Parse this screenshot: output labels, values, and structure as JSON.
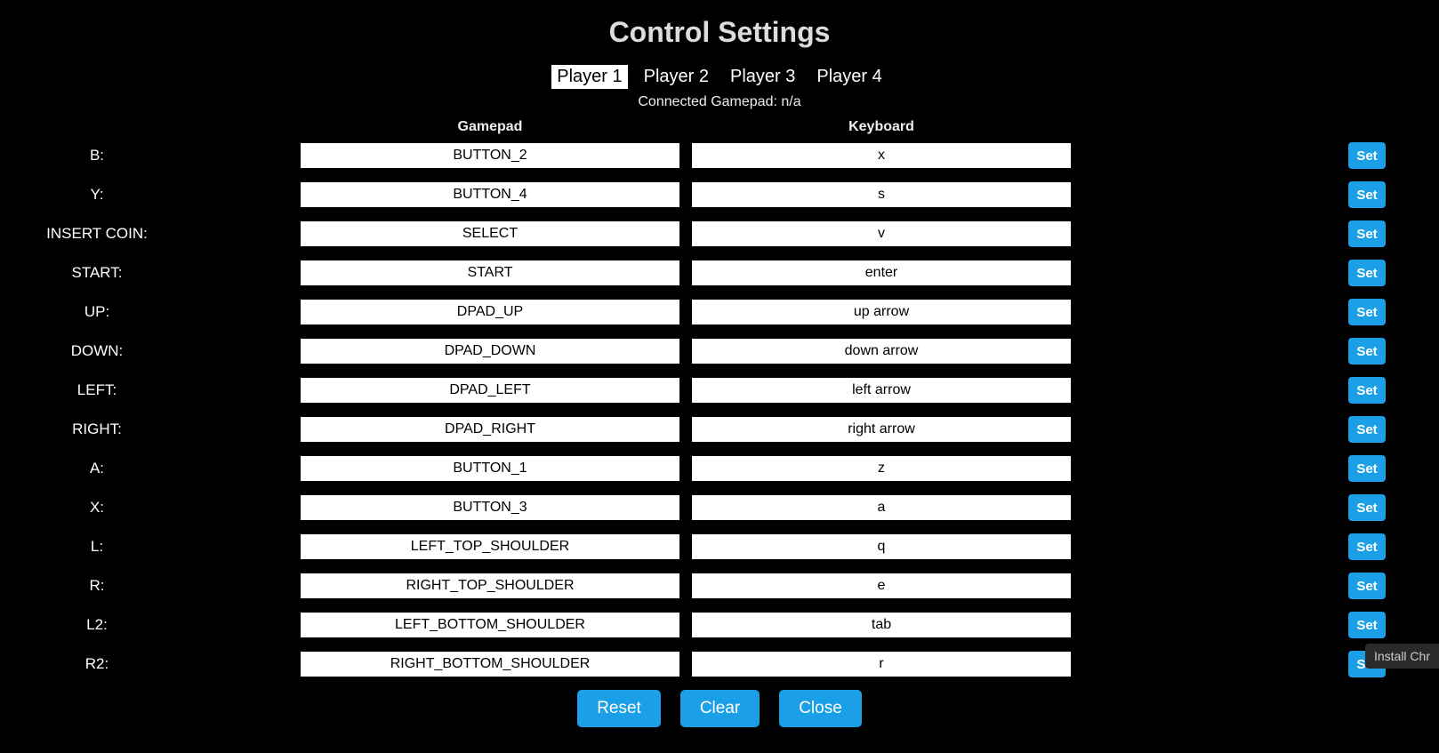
{
  "title": "Control Settings",
  "tabs": [
    "Player 1",
    "Player 2",
    "Player 3",
    "Player 4"
  ],
  "activeTab": 0,
  "connectedLabel": "Connected Gamepad: n/a",
  "headers": {
    "gamepad": "Gamepad",
    "keyboard": "Keyboard"
  },
  "setLabel": "Set",
  "rows": [
    {
      "label": "B:",
      "gamepad": "BUTTON_2",
      "keyboard": "x"
    },
    {
      "label": "Y:",
      "gamepad": "BUTTON_4",
      "keyboard": "s"
    },
    {
      "label": "INSERT COIN:",
      "gamepad": "SELECT",
      "keyboard": "v"
    },
    {
      "label": "START:",
      "gamepad": "START",
      "keyboard": "enter"
    },
    {
      "label": "UP:",
      "gamepad": "DPAD_UP",
      "keyboard": "up arrow"
    },
    {
      "label": "DOWN:",
      "gamepad": "DPAD_DOWN",
      "keyboard": "down arrow"
    },
    {
      "label": "LEFT:",
      "gamepad": "DPAD_LEFT",
      "keyboard": "left arrow"
    },
    {
      "label": "RIGHT:",
      "gamepad": "DPAD_RIGHT",
      "keyboard": "right arrow"
    },
    {
      "label": "A:",
      "gamepad": "BUTTON_1",
      "keyboard": "z"
    },
    {
      "label": "X:",
      "gamepad": "BUTTON_3",
      "keyboard": "a"
    },
    {
      "label": "L:",
      "gamepad": "LEFT_TOP_SHOULDER",
      "keyboard": "q"
    },
    {
      "label": "R:",
      "gamepad": "RIGHT_TOP_SHOULDER",
      "keyboard": "e"
    },
    {
      "label": "L2:",
      "gamepad": "LEFT_BOTTOM_SHOULDER",
      "keyboard": "tab"
    },
    {
      "label": "R2:",
      "gamepad": "RIGHT_BOTTOM_SHOULDER",
      "keyboard": "r"
    }
  ],
  "footer": {
    "reset": "Reset",
    "clear": "Clear",
    "close": "Close"
  },
  "installHint": "Install Chr"
}
